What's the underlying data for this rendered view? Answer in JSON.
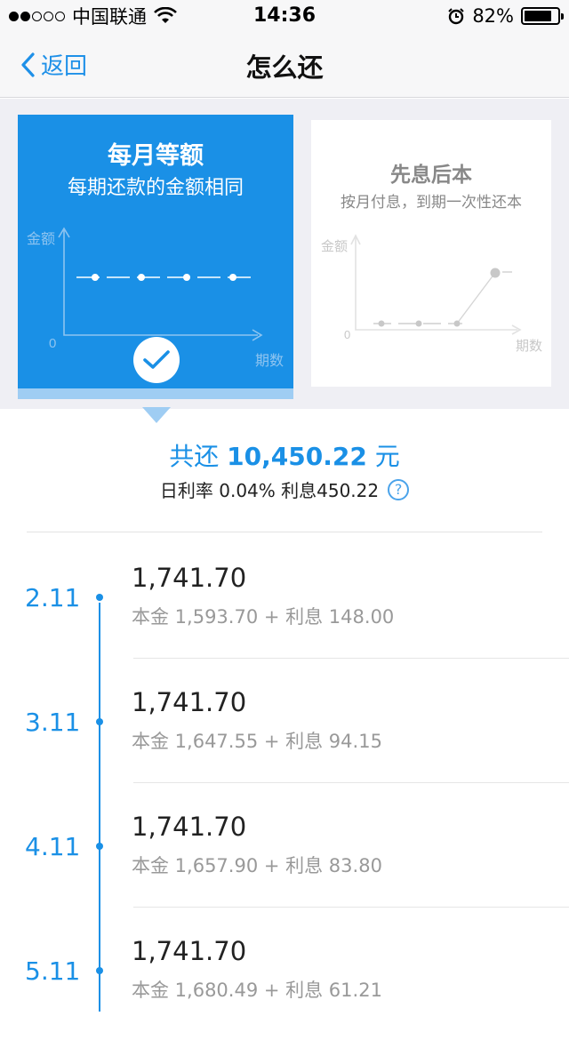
{
  "status_bar": {
    "carrier": "中国联通",
    "time": "14:36",
    "battery": "82%",
    "battery_level": 0.82
  },
  "nav": {
    "back_label": "返回",
    "title": "怎么还"
  },
  "plans": [
    {
      "title": "每月等额",
      "subtitle": "每期还款的金额相同",
      "y_label": "金额",
      "x_label": "期数",
      "origin": "0",
      "selected": true
    },
    {
      "title": "先息后本",
      "subtitle": "按月付息，到期一次性还本",
      "y_label": "金额",
      "x_label": "期数",
      "origin": "0",
      "selected": false
    }
  ],
  "summary": {
    "total_prefix": "共还",
    "total_amount": "10,450.22",
    "total_unit": "元",
    "rate_text": "日利率 0.04% 利息450.22",
    "help": "?"
  },
  "schedule": [
    {
      "date": "2.11",
      "amount": "1,741.70",
      "detail": "本金 1,593.70 + 利息 148.00"
    },
    {
      "date": "3.11",
      "amount": "1,741.70",
      "detail": "本金 1,647.55 + 利息 94.15"
    },
    {
      "date": "4.11",
      "amount": "1,741.70",
      "detail": "本金 1,657.90 + 利息 83.80"
    },
    {
      "date": "5.11",
      "amount": "1,741.70",
      "detail": "本金 1,680.49 + 利息 61.21"
    }
  ],
  "colors": {
    "accent": "#1a90e6",
    "accent_light": "#9fcdf3",
    "background": "#efeff4"
  }
}
